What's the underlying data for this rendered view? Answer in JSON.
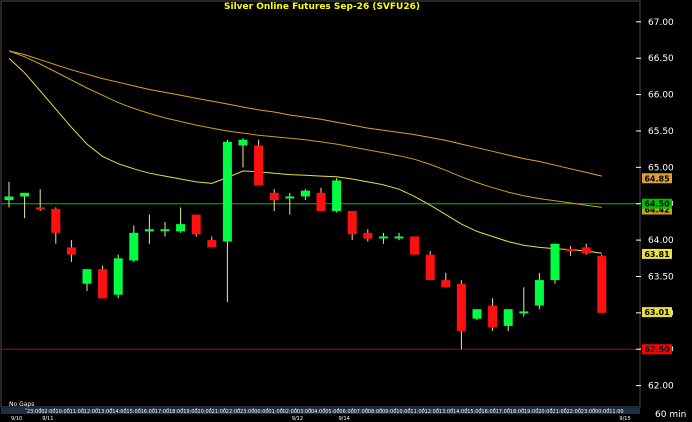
{
  "chart_data": {
    "type": "candlestick",
    "title": "Silver  Online  Futures  Sep-26  (SVFU26)",
    "ylim": [
      61.5,
      67.3
    ],
    "y_ticks": [
      "67.00",
      "66.50",
      "66.00",
      "65.50",
      "65.00",
      "64.50",
      "64.00",
      "63.50",
      "63.00",
      "62.50",
      "62.00"
    ],
    "y_tick_values": [
      67.0,
      66.5,
      66.0,
      65.5,
      65.0,
      64.5,
      64.0,
      63.5,
      63.0,
      62.5,
      62.0
    ],
    "candles": [
      [
        64.55,
        64.8,
        64.45,
        64.6
      ],
      [
        64.6,
        64.65,
        64.3,
        64.65
      ],
      [
        64.45,
        64.7,
        64.4,
        64.42
      ],
      [
        64.43,
        64.45,
        63.95,
        64.1
      ],
      [
        63.9,
        64.0,
        63.7,
        63.8
      ],
      [
        63.4,
        63.6,
        63.3,
        63.6
      ],
      [
        63.6,
        63.65,
        63.2,
        63.2
      ],
      [
        63.25,
        63.8,
        63.2,
        63.75
      ],
      [
        63.72,
        64.2,
        63.7,
        64.1
      ],
      [
        64.12,
        64.35,
        63.95,
        64.15
      ],
      [
        64.15,
        64.25,
        64.05,
        64.15
      ],
      [
        64.12,
        64.45,
        64.1,
        64.22
      ],
      [
        64.35,
        64.35,
        64.05,
        64.08
      ],
      [
        64.0,
        64.05,
        63.9,
        63.9
      ],
      [
        63.98,
        65.38,
        63.15,
        65.35
      ],
      [
        65.3,
        65.4,
        65.0,
        65.38
      ],
      [
        65.3,
        65.38,
        64.75,
        64.75
      ],
      [
        64.65,
        64.7,
        64.4,
        64.55
      ],
      [
        64.6,
        64.65,
        64.35,
        64.6
      ],
      [
        64.6,
        64.7,
        64.55,
        64.68
      ],
      [
        64.65,
        64.72,
        64.4,
        64.4
      ],
      [
        64.4,
        64.85,
        64.38,
        64.82
      ],
      [
        64.4,
        64.4,
        64.0,
        64.08
      ],
      [
        64.1,
        64.15,
        63.98,
        64.02
      ],
      [
        64.05,
        64.1,
        63.95,
        64.05
      ],
      [
        64.05,
        64.1,
        64.0,
        64.05
      ],
      [
        64.05,
        64.05,
        63.8,
        63.8
      ],
      [
        63.8,
        63.85,
        63.45,
        63.45
      ],
      [
        63.45,
        63.55,
        63.35,
        63.35
      ],
      [
        63.4,
        63.45,
        62.5,
        62.75
      ],
      [
        62.92,
        63.05,
        62.9,
        63.05
      ],
      [
        63.1,
        63.2,
        62.75,
        62.8
      ],
      [
        62.82,
        63.05,
        62.75,
        63.05
      ],
      [
        63.0,
        63.35,
        62.95,
        63.02
      ],
      [
        63.1,
        63.55,
        63.05,
        63.45
      ],
      [
        63.45,
        63.95,
        63.4,
        63.95
      ],
      [
        63.88,
        63.92,
        63.78,
        63.85
      ],
      [
        63.9,
        63.95,
        63.8,
        63.82
      ],
      [
        63.78,
        63.8,
        63.0,
        63.0
      ]
    ],
    "moving_averages": [
      {
        "color": "#e0a030",
        "values": [
          66.6,
          66.55,
          66.48,
          66.41,
          66.34,
          66.28,
          66.22,
          66.17,
          66.12,
          66.07,
          66.03,
          65.99,
          65.95,
          65.91,
          65.87,
          65.83,
          65.79,
          65.76,
          65.72,
          65.69,
          65.66,
          65.62,
          65.58,
          65.54,
          65.51,
          65.48,
          65.45,
          65.41,
          65.37,
          65.32,
          65.27,
          65.22,
          65.17,
          65.12,
          65.08,
          65.03,
          64.98,
          64.93,
          64.88
        ]
      },
      {
        "color": "#c8a020",
        "values": [
          66.6,
          66.52,
          66.42,
          66.31,
          66.2,
          66.09,
          65.99,
          65.89,
          65.81,
          65.74,
          65.68,
          65.63,
          65.58,
          65.54,
          65.5,
          65.47,
          65.44,
          65.42,
          65.4,
          65.38,
          65.35,
          65.32,
          65.28,
          65.24,
          65.2,
          65.16,
          65.11,
          65.04,
          64.96,
          64.87,
          64.79,
          64.72,
          64.66,
          64.61,
          64.57,
          64.54,
          64.51,
          64.48,
          64.45
        ]
      },
      {
        "color": "#e8e040",
        "values": [
          66.5,
          66.3,
          66.05,
          65.8,
          65.55,
          65.32,
          65.15,
          65.05,
          64.98,
          64.92,
          64.88,
          64.84,
          64.8,
          64.78,
          64.86,
          64.95,
          64.94,
          64.92,
          64.9,
          64.89,
          64.88,
          64.87,
          64.84,
          64.8,
          64.76,
          64.7,
          64.6,
          64.48,
          64.35,
          64.22,
          64.12,
          64.05,
          63.98,
          63.93,
          63.9,
          63.88,
          63.87,
          63.85,
          63.82
        ]
      }
    ],
    "hlines": [
      {
        "value": 64.5,
        "color": "#00c000",
        "label": "64.50"
      },
      {
        "value": 62.5,
        "color": "#c00000",
        "label": "62.50"
      }
    ],
    "price_tags": [
      {
        "label": "64.85",
        "bg": "#e0a030",
        "fg": "#000000",
        "value": 64.85
      },
      {
        "label": "64.42",
        "bg": "#c8a020",
        "fg": "#000000",
        "value": 64.42
      },
      {
        "label": "64.50",
        "bg": "#00c000",
        "fg": "#000000",
        "value": 64.5
      },
      {
        "label": "63.81",
        "bg": "#e8e040",
        "fg": "#000000",
        "value": 63.81
      },
      {
        "label": "63.01",
        "bg": "#e8e040",
        "fg": "#000000",
        "value": 63.01
      },
      {
        "label": "62.50",
        "bg": "#ff0000",
        "fg": "#000000",
        "value": 62.5
      }
    ],
    "x_time_labels": [
      "23:00",
      "02:00",
      "10:00",
      "11:00",
      "12:00",
      "13:00",
      "14:00",
      "15:00",
      "16:00",
      "17:00",
      "18:00",
      "19:00",
      "20:00",
      "21:00",
      "22:00",
      "23:00",
      "00:00",
      "01:00",
      "02:00",
      "03:00",
      "04:00",
      "05:00",
      "06:00",
      "07:00",
      "08:00",
      "09:00",
      "10:00",
      "11:00",
      "12:00",
      "13:00",
      "14:00",
      "15:00",
      "16:00",
      "17:00",
      "18:00",
      "19:00",
      "20:00",
      "21:00",
      "22:00",
      "23:00",
      "00:00",
      "11:00"
    ],
    "x_date_labels": [
      {
        "label": "9/10",
        "index": 0
      },
      {
        "label": "9/11",
        "index": 2
      },
      {
        "label": "9/12",
        "index": 18
      },
      {
        "label": "9/14",
        "index": 21
      },
      {
        "label": "9/15",
        "index": 39
      }
    ],
    "no_gaps_label": "No Gaps",
    "interval_label": "60  min"
  }
}
